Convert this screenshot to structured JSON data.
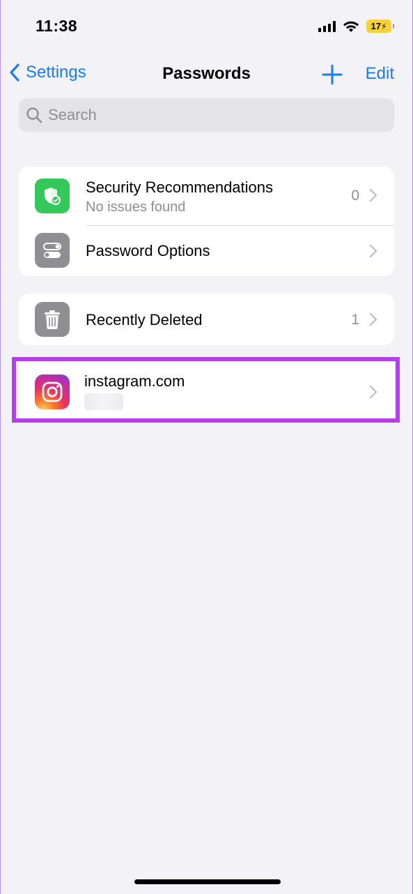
{
  "status_bar": {
    "time": "11:38",
    "battery_level": "17"
  },
  "nav": {
    "back_label": "Settings",
    "title": "Passwords",
    "edit_label": "Edit"
  },
  "search": {
    "placeholder": "Search"
  },
  "sections": {
    "security": {
      "title": "Security Recommendations",
      "subtitle": "No issues found",
      "count": "0",
      "icon": "shield-check-icon",
      "icon_color": "#34c759"
    },
    "options": {
      "title": "Password Options",
      "icon": "toggle-icon",
      "icon_color": "#8e8e93"
    },
    "deleted": {
      "title": "Recently Deleted",
      "count": "1",
      "icon": "trash-icon",
      "icon_color": "#8e8e93"
    },
    "accounts": [
      {
        "site": "instagram.com",
        "icon": "instagram-icon"
      }
    ]
  },
  "colors": {
    "accent": "#1a7cf0",
    "highlight_border": "#b23ff0",
    "background": "#f2f2f7"
  }
}
